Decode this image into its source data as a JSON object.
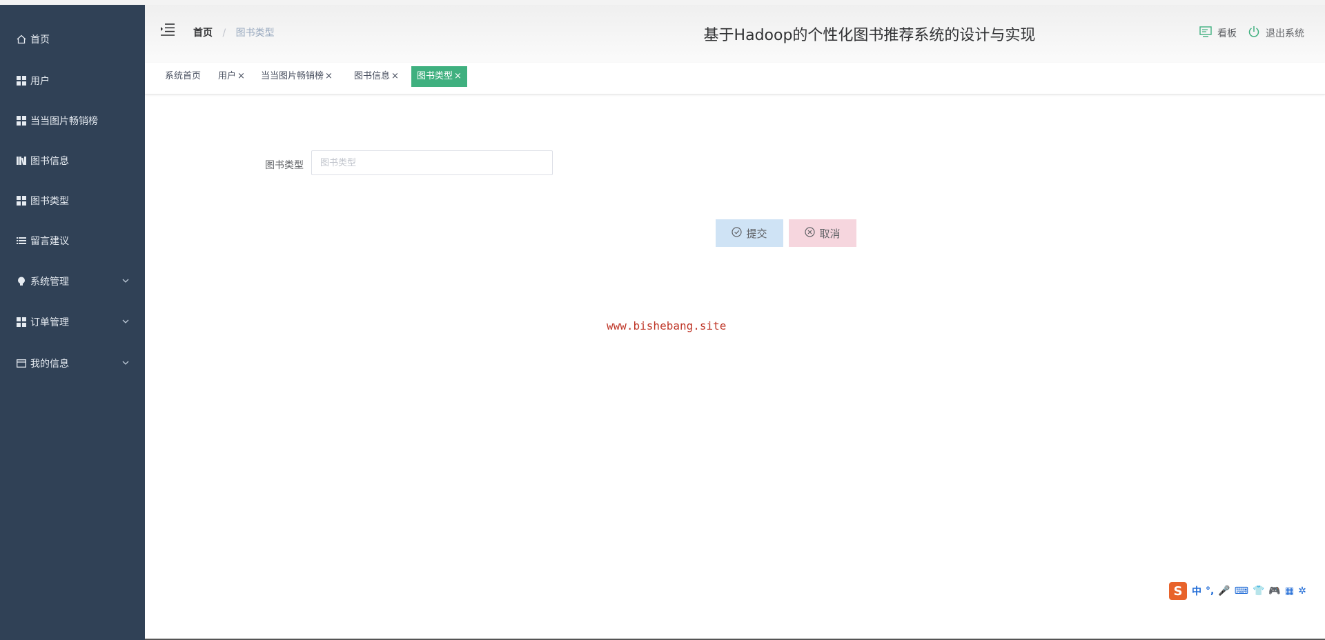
{
  "sidebar": {
    "items": [
      {
        "label": "首页",
        "icon": "home-icon"
      },
      {
        "label": "用户",
        "icon": "grid-icon"
      },
      {
        "label": "当当图片畅销榜",
        "icon": "grid-icon"
      },
      {
        "label": "图书信息",
        "icon": "books-icon"
      },
      {
        "label": "图书类型",
        "icon": "grid-icon"
      },
      {
        "label": "留言建议",
        "icon": "list-icon"
      },
      {
        "label": "系统管理",
        "icon": "bulb-icon"
      },
      {
        "label": "订单管理",
        "icon": "grid-icon"
      },
      {
        "label": "我的信息",
        "icon": "card-icon"
      }
    ]
  },
  "header": {
    "breadcrumb_home": "首页",
    "breadcrumb_current": "图书类型",
    "title": "基于Hadoop的个性化图书推荐系统的设计与实现",
    "board_label": "看板",
    "logout_label": "退出系统"
  },
  "tags": [
    {
      "label": "系统首页",
      "closable": false
    },
    {
      "label": "用户",
      "closable": true
    },
    {
      "label": "当当图片畅销榜",
      "closable": true
    },
    {
      "label": "图书信息",
      "closable": true
    },
    {
      "label": "图书类型",
      "closable": true,
      "active": true
    }
  ],
  "tag_close": "×",
  "form": {
    "type_label": "图书类型",
    "type_placeholder": "图书类型",
    "type_value": "",
    "submit_label": "提交",
    "cancel_label": "取消"
  },
  "watermark": "www.bishebang.site",
  "ime": {
    "logo": "S",
    "glyphs": [
      "中",
      "°,",
      "🎤",
      "⌨",
      "👕",
      "🎮",
      "▦",
      "✲"
    ]
  },
  "colors": {
    "sidebar_bg": "#304156",
    "active_tag": "#3fb07f",
    "submit_bg": "#cfe3f5",
    "cancel_bg": "#f6d6de",
    "watermark": "#c0392b"
  }
}
